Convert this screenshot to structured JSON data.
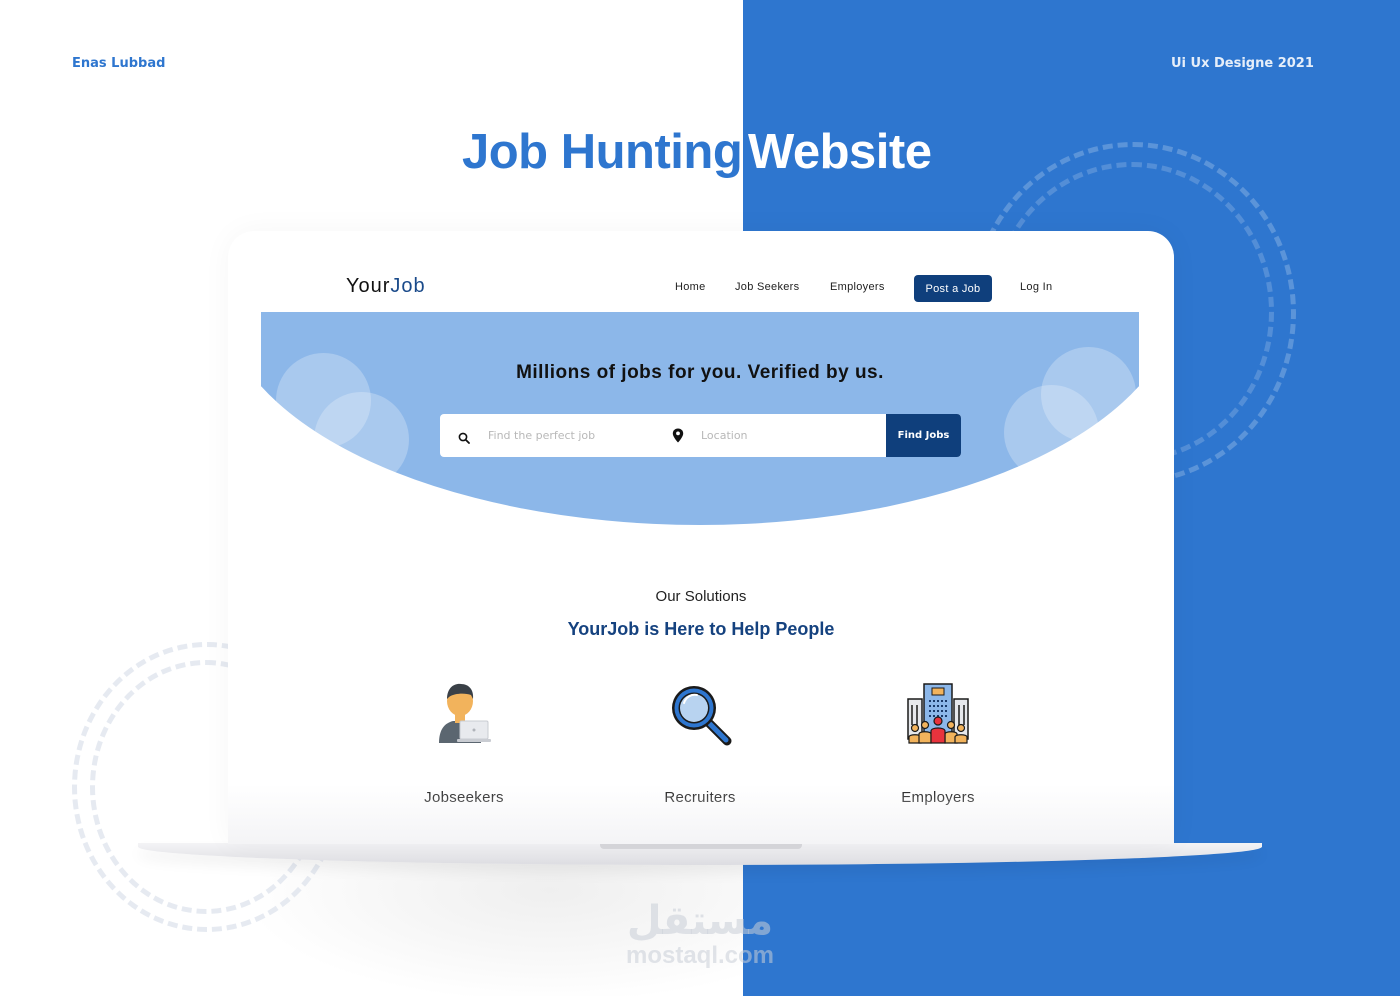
{
  "author": "Enas Lubbad",
  "project_year": "Ui Ux Designe 2021",
  "title": {
    "part1": "Job Hunting",
    "part2": "Website"
  },
  "colors": {
    "brand_blue": "#2e76cf",
    "navy": "#0f3f7c",
    "hero_blue": "#8cb7e9",
    "heading_navy": "#15427f"
  },
  "site": {
    "logo": {
      "part1": "Your",
      "part2": "Job"
    },
    "nav": {
      "items": [
        "Home",
        "Job Seekers",
        "Employers"
      ],
      "cta": "Post a Job",
      "login": "Log In"
    },
    "hero": {
      "headline": "Millions of jobs for you. Verified by us.",
      "search": {
        "job_placeholder": "Find the perfect job",
        "job_value": "",
        "job_icon": "search-icon",
        "location_placeholder": "Location",
        "location_value": "",
        "location_icon": "map-pin-icon",
        "button": "Find Jobs"
      }
    },
    "solutions": {
      "subtitle": "Our Solutions",
      "title": "YourJob is Here to Help People",
      "cards": [
        {
          "label": "Jobseekers",
          "icon": "person-laptop-icon"
        },
        {
          "label": "Recruiters",
          "icon": "magnifier-icon"
        },
        {
          "label": "Employers",
          "icon": "buildings-people-icon"
        }
      ]
    }
  },
  "watermark": {
    "arabic": "مستقل",
    "latin": "mostaql.com"
  }
}
